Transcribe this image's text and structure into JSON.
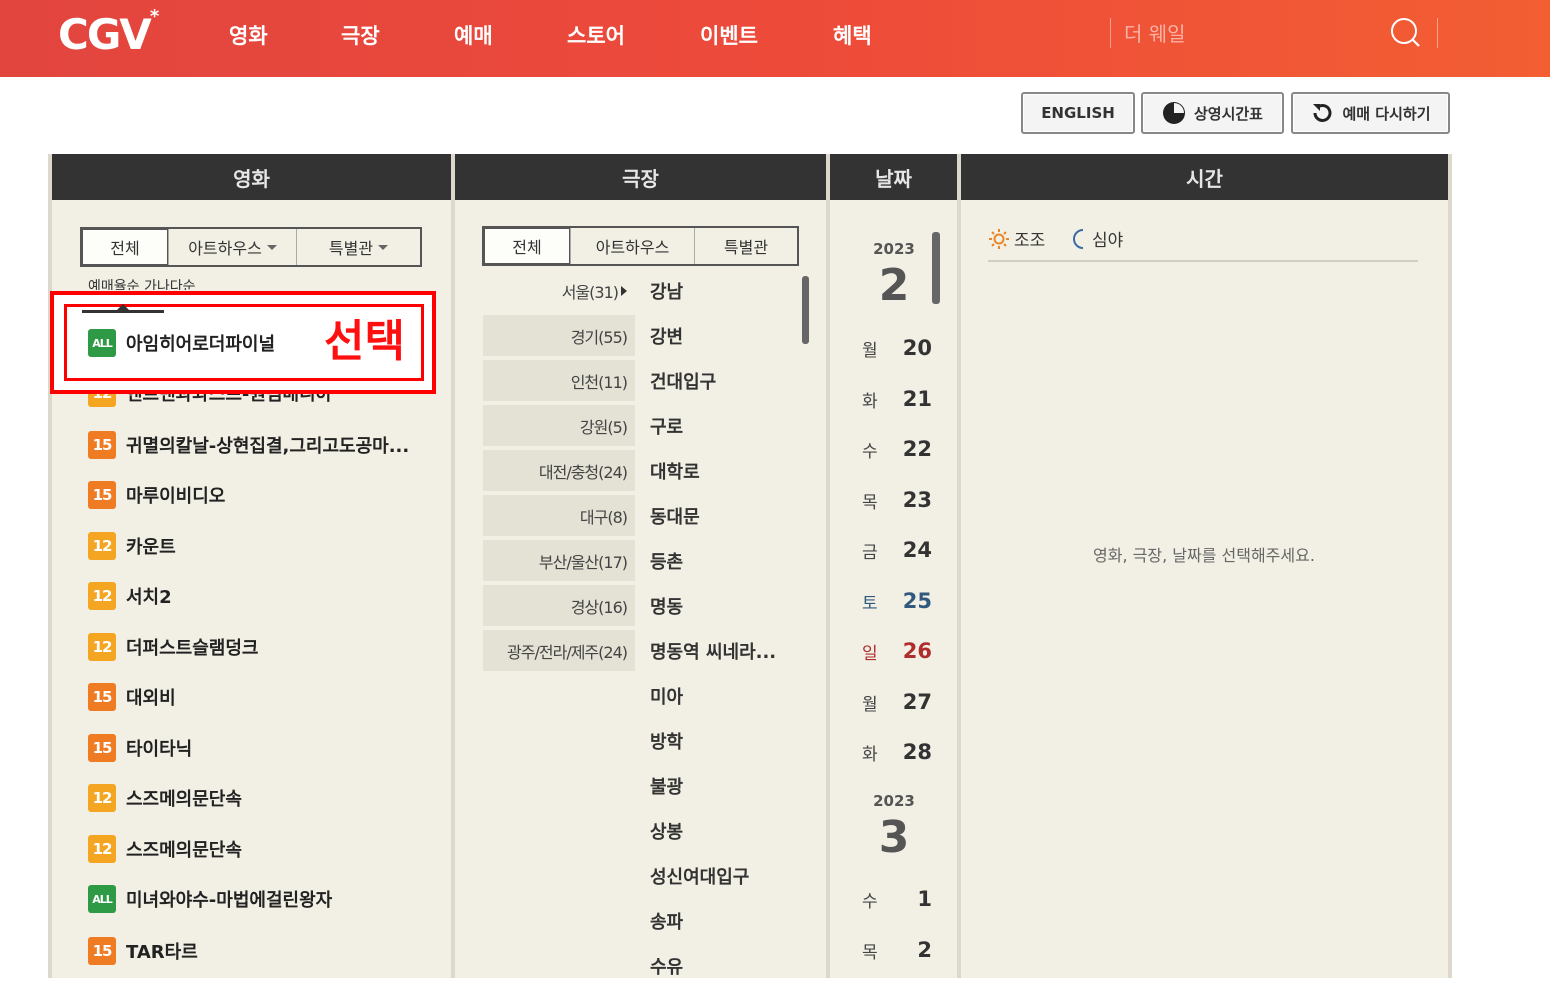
{
  "header": {
    "logo_text": "CGV",
    "logo_mark": "*",
    "nav": [
      "영화",
      "극장",
      "예매",
      "스토어",
      "이벤트",
      "혜택"
    ],
    "search_value": "",
    "search_placeholder": "더 웨일"
  },
  "actions": {
    "english": "ENGLISH",
    "schedule": "상영시간표",
    "restart": "예매 다시하기"
  },
  "columns": {
    "movie": "영화",
    "theater": "극장",
    "date": "날짜",
    "time": "시간"
  },
  "movie_panel": {
    "tabs": [
      "전체",
      "아트하우스",
      "특별관"
    ],
    "sort_label": "예매율순   가나다순",
    "selected_label": "선택",
    "movies": [
      {
        "rating": "ALL",
        "rating_class": "all",
        "title": "아임히어로더파이널"
      },
      {
        "rating": "12",
        "rating_class": "r12",
        "title": "앤트맨과와스프-퀀텀매니아"
      },
      {
        "rating": "15",
        "rating_class": "r15",
        "title": "귀멸의칼날-상현집결,그리고도공마..."
      },
      {
        "rating": "15",
        "rating_class": "r15",
        "title": "마루이비디오"
      },
      {
        "rating": "12",
        "rating_class": "r12",
        "title": "카운트"
      },
      {
        "rating": "12",
        "rating_class": "r12",
        "title": "서치2"
      },
      {
        "rating": "12",
        "rating_class": "r12",
        "title": "더퍼스트슬램덩크"
      },
      {
        "rating": "15",
        "rating_class": "r15",
        "title": "대외비"
      },
      {
        "rating": "15",
        "rating_class": "r15",
        "title": "타이타닉"
      },
      {
        "rating": "12",
        "rating_class": "r12",
        "title": "스즈메의문단속"
      },
      {
        "rating": "12",
        "rating_class": "r12",
        "title": "스즈메의문단속"
      },
      {
        "rating": "ALL",
        "rating_class": "all",
        "title": "미녀와야수-마법에걸린왕자"
      },
      {
        "rating": "15",
        "rating_class": "r15",
        "title": "TAR타르"
      }
    ]
  },
  "theater_panel": {
    "tabs": [
      "전체",
      "아트하우스",
      "특별관"
    ],
    "regions": [
      "서울(31)",
      "경기(55)",
      "인천(11)",
      "강원(5)",
      "대전/충청(24)",
      "대구(8)",
      "부산/울산(17)",
      "경상(16)",
      "광주/전라/제주(24)"
    ],
    "theaters": [
      "강남",
      "강변",
      "건대입구",
      "구로",
      "대학로",
      "동대문",
      "등촌",
      "명동",
      "명동역 씨네라...",
      "미아",
      "방학",
      "불광",
      "상봉",
      "성신여대입구",
      "송파",
      "수유"
    ]
  },
  "date_panel": {
    "groups": [
      {
        "year": "2023",
        "month": "2",
        "days": [
          {
            "dow": "월",
            "day": "20",
            "type": "weekday"
          },
          {
            "dow": "화",
            "day": "21",
            "type": "weekday"
          },
          {
            "dow": "수",
            "day": "22",
            "type": "weekday"
          },
          {
            "dow": "목",
            "day": "23",
            "type": "weekday"
          },
          {
            "dow": "금",
            "day": "24",
            "type": "weekday"
          },
          {
            "dow": "토",
            "day": "25",
            "type": "sat"
          },
          {
            "dow": "일",
            "day": "26",
            "type": "sun"
          },
          {
            "dow": "월",
            "day": "27",
            "type": "weekday"
          },
          {
            "dow": "화",
            "day": "28",
            "type": "weekday"
          }
        ]
      },
      {
        "year": "2023",
        "month": "3",
        "days": [
          {
            "dow": "수",
            "day": "1",
            "type": "weekday"
          },
          {
            "dow": "목",
            "day": "2",
            "type": "weekday"
          }
        ]
      }
    ]
  },
  "time_panel": {
    "morning_label": "조조",
    "night_label": "심야",
    "message": "영화, 극장, 날짜를 선택해주세요."
  },
  "colors": {
    "header_start": "#e2453e",
    "header_end": "#f35e33",
    "column_header": "#333333",
    "panel_bg": "#f2f0e5",
    "highlight": "#ff0000",
    "saturday": "#31597e",
    "sunday": "#af2d2d"
  }
}
